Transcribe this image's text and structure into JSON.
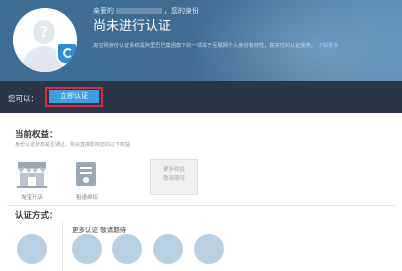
{
  "hero": {
    "greeting_prefix": "亲爱的",
    "greeting_suffix": "，您的身份",
    "status_title": "尚未进行认证",
    "description": "淘宝网身份认证系统是阿里巴巴集团旗下的一项关于互联网个人身份有效性，真实性的认证服务。",
    "learn_more": "了解更多"
  },
  "action_bar": {
    "label": "您可以：",
    "primary_button": "立即认证"
  },
  "benefits": {
    "title": "当前权益：",
    "note": "身份认证状态是否通过，将会直接影响您的以下权益",
    "items": [
      {
        "label": "淘宝开店",
        "icon": "shop-icon"
      },
      {
        "label": "租速维权",
        "icon": "rights-document-icon"
      }
    ],
    "more_line1": "更多权益",
    "more_line2": "敬请期待"
  },
  "auth_methods": {
    "title": "认证方式：",
    "more_label": "更多认证 敬请期待"
  },
  "colors": {
    "hero_bg": "#3f6c92",
    "bar_bg": "#2b3748",
    "button_bg": "#3aa0e6",
    "highlight_border": "#e8253a"
  }
}
